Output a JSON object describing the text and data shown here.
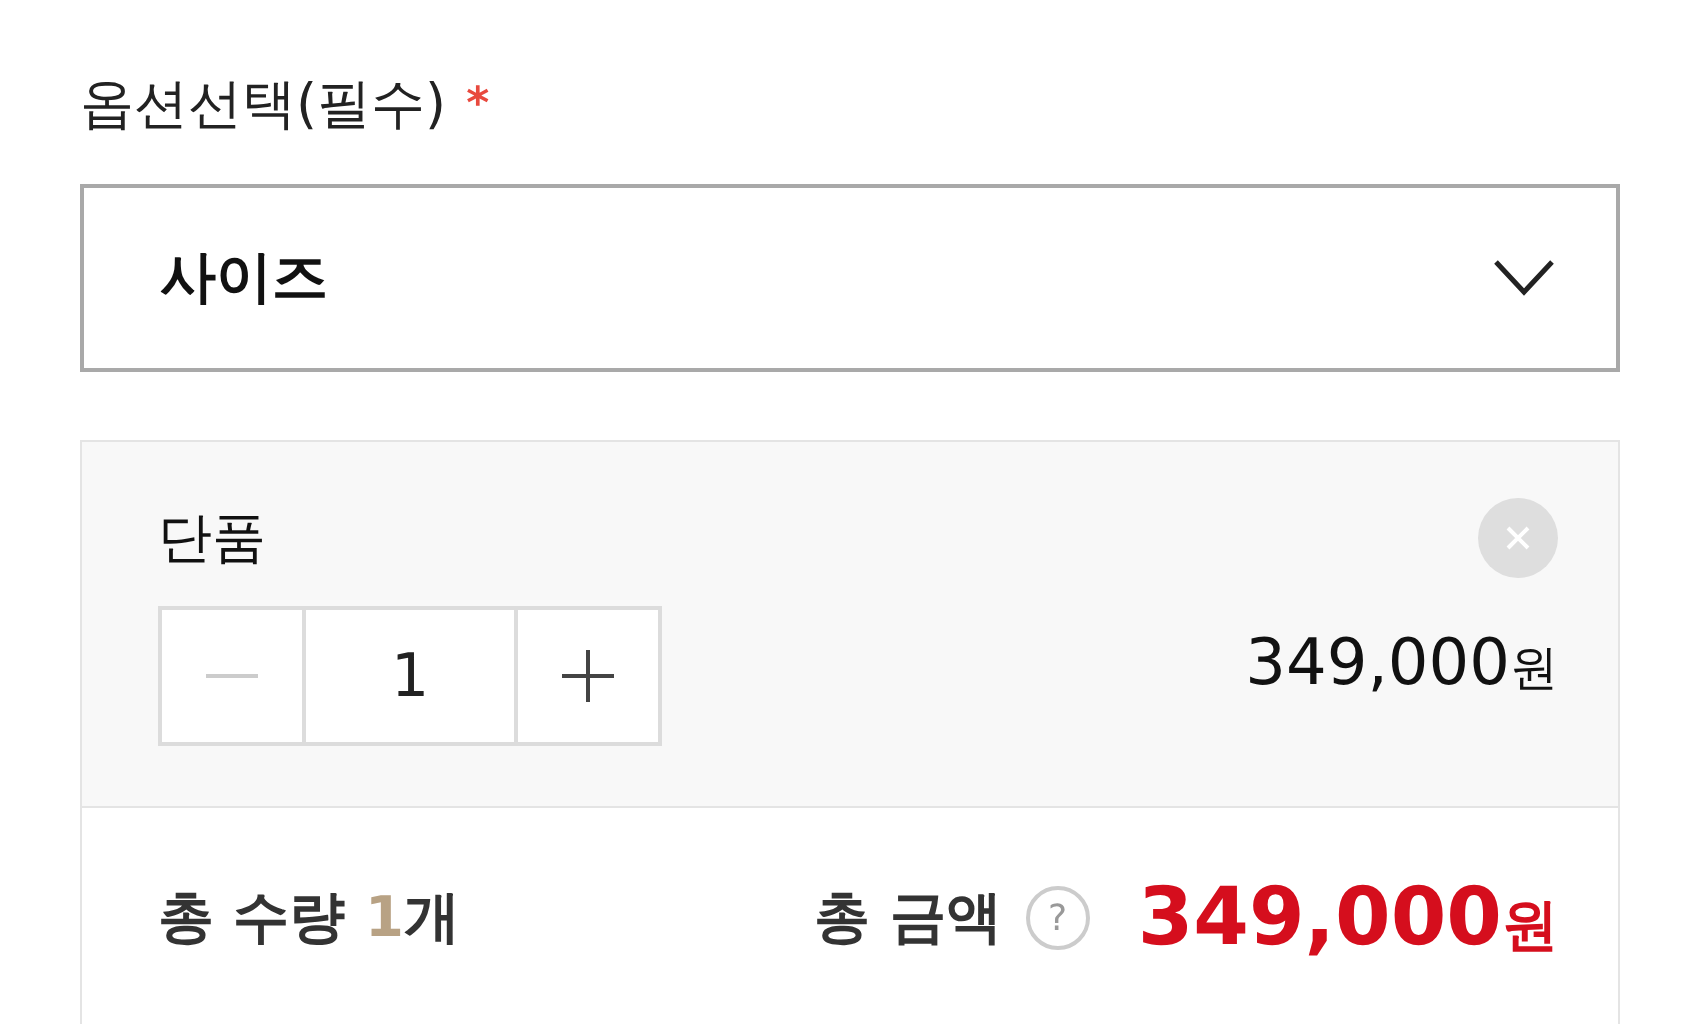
{
  "option_label": {
    "text": "옵션선택(필수)",
    "required_mark": "*"
  },
  "select": {
    "value": "사이즈",
    "expanded": false
  },
  "items": [
    {
      "name": "단품",
      "quantity": "1",
      "price": "349,000",
      "unit": "원"
    }
  ],
  "summary": {
    "quantity_label": "총 수량",
    "quantity": "1",
    "quantity_unit": "개",
    "total_label": "총 금액",
    "help": "?",
    "total": "349,000",
    "total_unit": "원"
  }
}
